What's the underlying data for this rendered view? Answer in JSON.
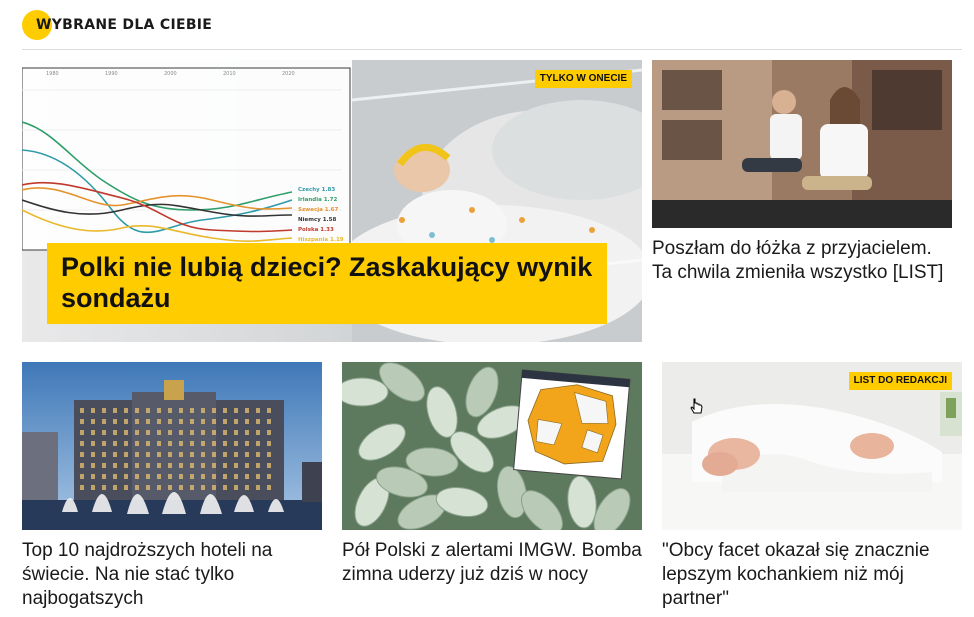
{
  "section": {
    "title": "WYBRANE DLA CIEBIE",
    "accent": "#ffcc00"
  },
  "hero": {
    "badge": "TYLKO W ONECIE",
    "title": "Polki nie lubią dzieci? Zaskakujący wynik sondażu",
    "chart": {
      "x_ticks": [
        "1980",
        "1990",
        "2000",
        "2010",
        "2020"
      ],
      "legend": [
        {
          "label": "Czechy 1.83",
          "color": "#2f9aa8"
        },
        {
          "label": "Irlandia 1.72",
          "color": "#2e9e6a"
        },
        {
          "label": "Szwecja 1.67",
          "color": "#e6932e"
        },
        {
          "label": "Niemcy 1.58",
          "color": "#333333"
        },
        {
          "label": "Polska 1.33",
          "color": "#c0392b"
        },
        {
          "label": "Hiszpania 1.19",
          "color": "#e8b92a"
        }
      ]
    }
  },
  "side": {
    "title": "Poszłam do łóżka z przyjacielem. Ta chwila zmieniła wszystko [LIST]"
  },
  "cards": [
    {
      "title": "Top 10 najdroższych hoteli na świecie. Na nie stać tylko najbogatszych"
    },
    {
      "title": "Pół Polski z alertami IMGW. Bomba zimna uderzy już dziś w nocy"
    },
    {
      "badge": "LIST DO REDAKCJI",
      "title": "\"Obcy facet okazał się znacznie lepszym kochankiem niż mój partner\""
    }
  ]
}
